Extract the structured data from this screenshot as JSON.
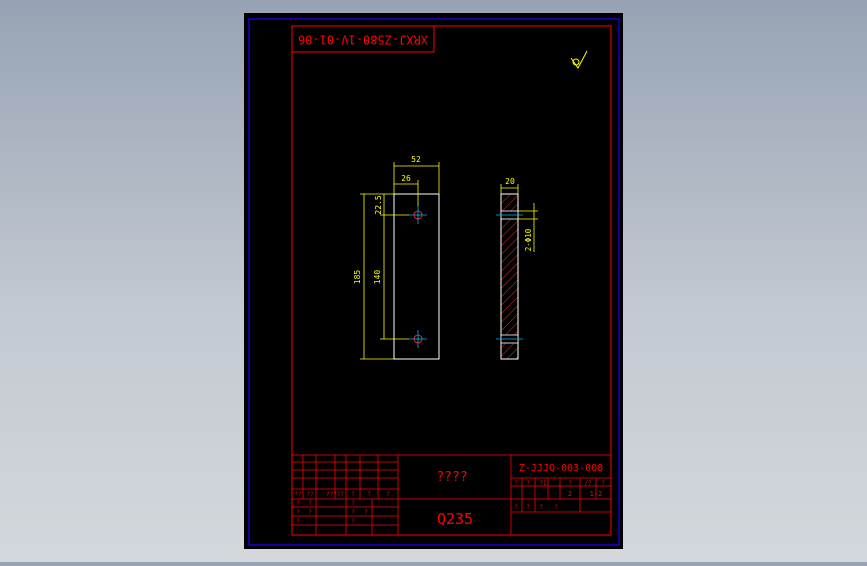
{
  "drawing": {
    "stamp_text": "XRXJ-Z580-1V-01-06",
    "roughness_symbol": "√",
    "title_block": {
      "part_name": "????",
      "material": "Q235",
      "drawing_number": "Z-JJJQ-003-008",
      "scale": "1:2",
      "sheet_count": "2",
      "header_marks": [
        "?",
        "?",
        "?1",
        "?",
        "/?",
        "?"
      ],
      "left_header_marks": [
        "?",
        "?",
        "?",
        "?",
        "?",
        "?"
      ],
      "left_row_marks": [
        "??",
        "??",
        "?????",
        "?",
        "?",
        "?"
      ],
      "left_small_marks": [
        "?",
        "?",
        "?",
        "?",
        "?",
        "?",
        "?",
        "?",
        "?"
      ],
      "right_small_marks": [
        "?",
        "?",
        "?",
        "?"
      ]
    },
    "dimensions": {
      "overall_width": "52",
      "hole_offset": "26",
      "top_offset": "22.5",
      "overall_height": "185",
      "hole_spacing": "140",
      "thickness": "20",
      "hole_callout": "2-Φ10"
    },
    "colors": {
      "background": "#000000",
      "frame": "#ff0000",
      "dimension": "#ffff00",
      "part_outline": "#ffffff",
      "centerline": "#00b7ff",
      "hatch": "#ff3b3b",
      "outer_border": "#2000ff"
    }
  }
}
